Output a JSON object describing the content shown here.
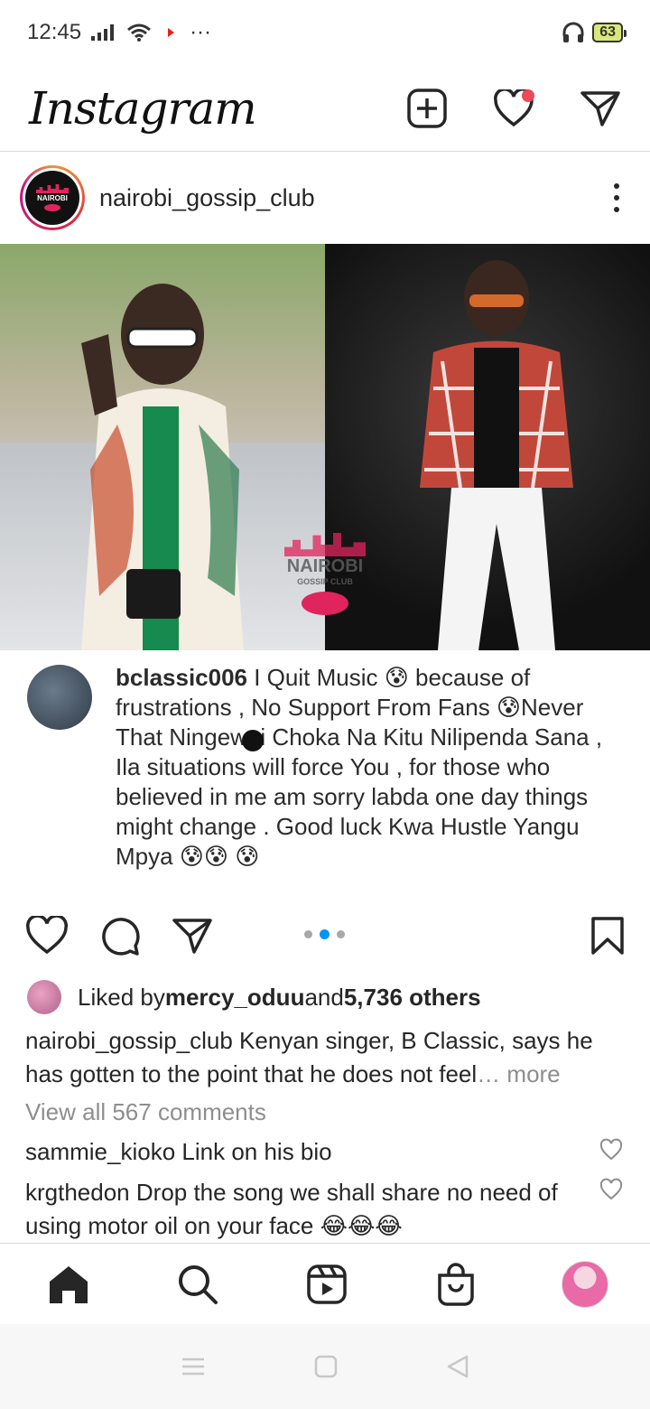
{
  "status_bar": {
    "time": "12:45",
    "overflow": "···",
    "battery": "63"
  },
  "header": {
    "logo": "Instagram"
  },
  "post": {
    "username": "nairobi_gossip_club",
    "watermark_title": "NAIROBI",
    "watermark_sub": "GOSSIP CLUB",
    "quoted": {
      "username": "bclassic006",
      "text": " I Quit Music 😰 because of frustrations , No Support From Fans 😰Never That Ningewai Choka Na Kitu Nilipenda Sana , Ila situations will force You , for those who believed in me am sorry labda one day things might change . Good luck Kwa Hustle Yangu Mpya 😰😰 😰"
    },
    "carousel": {
      "count": 3,
      "active_index": 1
    },
    "likes": {
      "prefix": "Liked by ",
      "user": "mercy_oduu",
      "and": " and ",
      "others": "5,736 others"
    },
    "caption": {
      "user": "nairobi_gossip_club",
      "text": " Kenyan singer, B Classic, says he has gotten to the point that he does not feel",
      "ellipsis": "… ",
      "more": "more"
    },
    "view_all": "View all 567 comments",
    "comments": [
      {
        "user": "sammie_kioko",
        "text": " Link on his bio"
      },
      {
        "user": "krgthedon",
        "text": " Drop the song we shall share no need of using motor oil on your face 😂😂😂"
      }
    ]
  },
  "colors": {
    "accent_blue": "#0095f6",
    "notification_red": "#ed4956",
    "text": "#262626",
    "muted": "#8e8e8e"
  },
  "icons": {
    "header": [
      "new-post-icon",
      "heart-icon",
      "direct-message-icon"
    ],
    "actions": [
      "like-icon",
      "comment-icon",
      "share-icon",
      "save-icon"
    ],
    "bottom_nav": [
      "home-icon",
      "search-icon",
      "reels-icon",
      "shop-icon",
      "profile-avatar"
    ]
  }
}
